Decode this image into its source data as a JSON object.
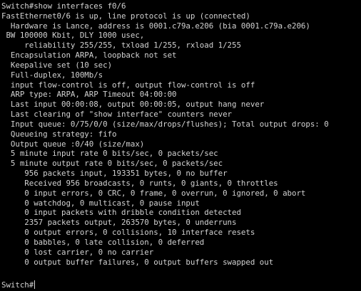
{
  "terminal": {
    "lines": [
      "Switch#show interfaces f0/6",
      "FastEthernet0/6 is up, line protocol is up (connected)",
      "  Hardware is Lance, address is 0001.c79a.e206 (bia 0001.c79a.e206)",
      " BW 100000 Kbit, DLY 1000 usec,",
      "     reliability 255/255, txload 1/255, rxload 1/255",
      "  Encapsulation ARPA, loopback not set",
      "  Keepalive set (10 sec)",
      "  Full-duplex, 100Mb/s",
      "  input flow-control is off, output flow-control is off",
      "  ARP type: ARPA, ARP Timeout 04:00:00",
      "  Last input 00:00:08, output 00:00:05, output hang never",
      "  Last clearing of \"show interface\" counters never",
      "  Input queue: 0/75/0/0 (size/max/drops/flushes); Total output drops: 0",
      "  Queueing strategy: fifo",
      "  Output queue :0/40 (size/max)",
      "  5 minute input rate 0 bits/sec, 0 packets/sec",
      "  5 minute output rate 0 bits/sec, 0 packets/sec",
      "     956 packets input, 193351 bytes, 0 no buffer",
      "     Received 956 broadcasts, 0 runts, 0 giants, 0 throttles",
      "     0 input errors, 0 CRC, 0 frame, 0 overrun, 0 ignored, 0 abort",
      "     0 watchdog, 0 multicast, 0 pause input",
      "     0 input packets with dribble condition detected",
      "     2357 packets output, 263570 bytes, 0 underruns",
      "     0 output errors, 0 collisions, 10 interface resets",
      "     0 babbles, 0 late collision, 0 deferred",
      "     0 lost carrier, 0 no carrier",
      "     0 output buffer failures, 0 output buffers swapped out",
      ""
    ],
    "prompt": "Switch#",
    "colors": {
      "background": "#000000",
      "text": "#d2d2d2"
    }
  }
}
